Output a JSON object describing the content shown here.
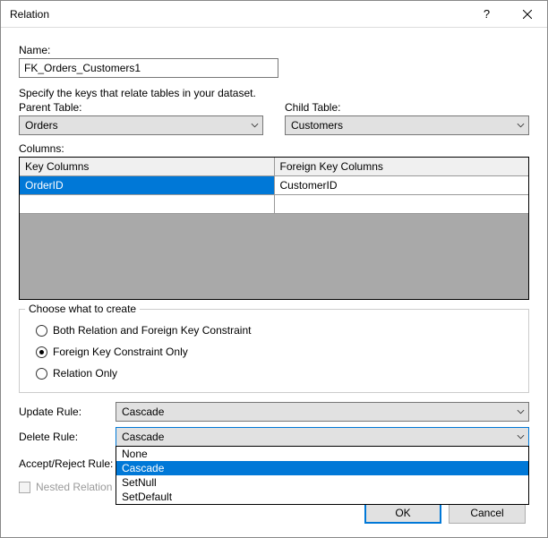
{
  "titlebar": {
    "title": "Relation",
    "help_tooltip": "?",
    "close_tooltip": "Close"
  },
  "name_section": {
    "label": "Name:",
    "value": "FK_Orders_Customers1"
  },
  "hint": "Specify the keys that relate tables in your dataset.",
  "tables": {
    "parent_label": "Parent Table:",
    "parent_value": "Orders",
    "child_label": "Child Table:",
    "child_value": "Customers"
  },
  "columns": {
    "label": "Columns:",
    "header_key": "Key Columns",
    "header_fk": "Foreign Key Columns",
    "rows": [
      {
        "key": "OrderID",
        "fk": "CustomerID",
        "selected": true
      },
      {
        "key": "",
        "fk": "",
        "selected": false
      }
    ]
  },
  "create_group": {
    "legend": "Choose what to create",
    "options": [
      {
        "label": "Both Relation and Foreign Key Constraint",
        "checked": false
      },
      {
        "label": "Foreign Key Constraint Only",
        "checked": true
      },
      {
        "label": "Relation Only",
        "checked": false
      }
    ]
  },
  "rules": {
    "update_label": "Update Rule:",
    "update_value": "Cascade",
    "delete_label": "Delete Rule:",
    "delete_value": "Cascade",
    "delete_options": [
      "None",
      "Cascade",
      "SetNull",
      "SetDefault"
    ],
    "delete_selected_index": 1,
    "accept_label": "Accept/Reject Rule:"
  },
  "nested": {
    "label": "Nested Relation",
    "enabled": false,
    "checked": false
  },
  "buttons": {
    "ok": "OK",
    "cancel": "Cancel"
  }
}
